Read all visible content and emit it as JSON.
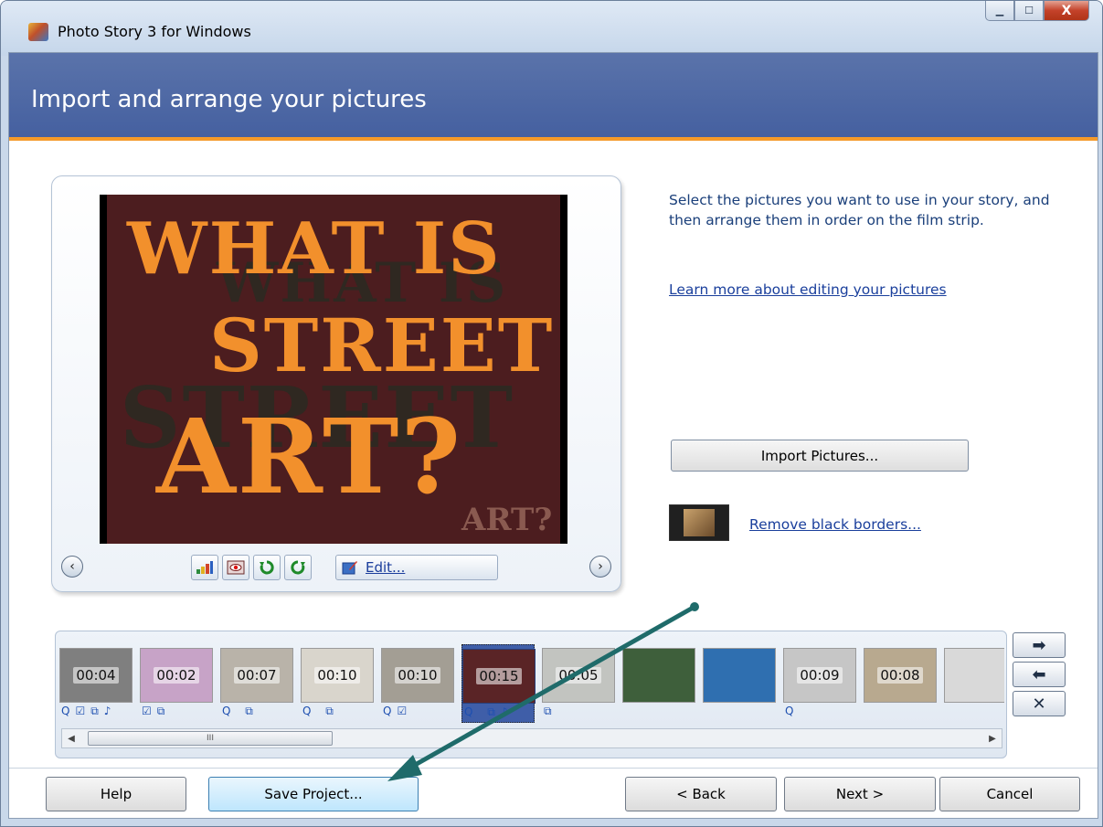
{
  "window": {
    "title": "Photo Story 3 for Windows",
    "controls": {
      "minimize": "▁",
      "maximize": "☐",
      "close": "X"
    }
  },
  "header": {
    "title": "Import and arrange your pictures"
  },
  "preview": {
    "slide_lines": [
      "WHAT IS",
      "STREET",
      "ART?"
    ],
    "slide_small": "ART?",
    "edit_label": "Edit..."
  },
  "right_panel": {
    "instructions": "Select the pictures you want to use in your story, and then arrange them in order on the film strip.",
    "learn_link": "Learn more about editing your pictures",
    "import_button": "Import Pictures...",
    "remove_borders_link": "Remove black borders..."
  },
  "filmstrip": {
    "frames": [
      {
        "duration": "00:04",
        "icons": "Q☑⧉♪",
        "bg": "#7f7f7f"
      },
      {
        "duration": "00:02",
        "icons": "☑⧉",
        "bg": "#c7a3c7"
      },
      {
        "duration": "00:07",
        "icons": "Q ⧉",
        "bg": "#b9b3a9"
      },
      {
        "duration": "00:10",
        "icons": "Q ⧉",
        "bg": "#d9d5cc"
      },
      {
        "duration": "00:10",
        "icons": "Q☑",
        "bg": "#a39e94"
      },
      {
        "duration": "00:15",
        "icons": "Q ⧉♪",
        "bg": "#5a2426",
        "selected": true
      },
      {
        "duration": "00:05",
        "icons": "⧉",
        "bg": "#c2c4c0"
      },
      {
        "duration": "",
        "icons": "",
        "bg": "#3e5f3b"
      },
      {
        "duration": "",
        "icons": "",
        "bg": "#2f6fb0"
      },
      {
        "duration": "00:09",
        "icons": "Q",
        "bg": "#c6c6c6"
      },
      {
        "duration": "00:08",
        "icons": "",
        "bg": "#b8a98f"
      },
      {
        "duration": "",
        "icons": "",
        "bg": "#d9d9d9"
      }
    ],
    "scroll_thumb_grip": "III"
  },
  "side_controls": {
    "move_right": "➡",
    "move_left": "⬅",
    "remove": "✕"
  },
  "footer": {
    "help": "Help",
    "save": "Save Project...",
    "back": "< Back",
    "next": "Next >",
    "cancel": "Cancel"
  },
  "colors": {
    "banner": "#4f69a6",
    "banner_accent": "#f59a2a",
    "link": "#1a3f9c",
    "annotation_arrow": "#1f6b6a"
  }
}
